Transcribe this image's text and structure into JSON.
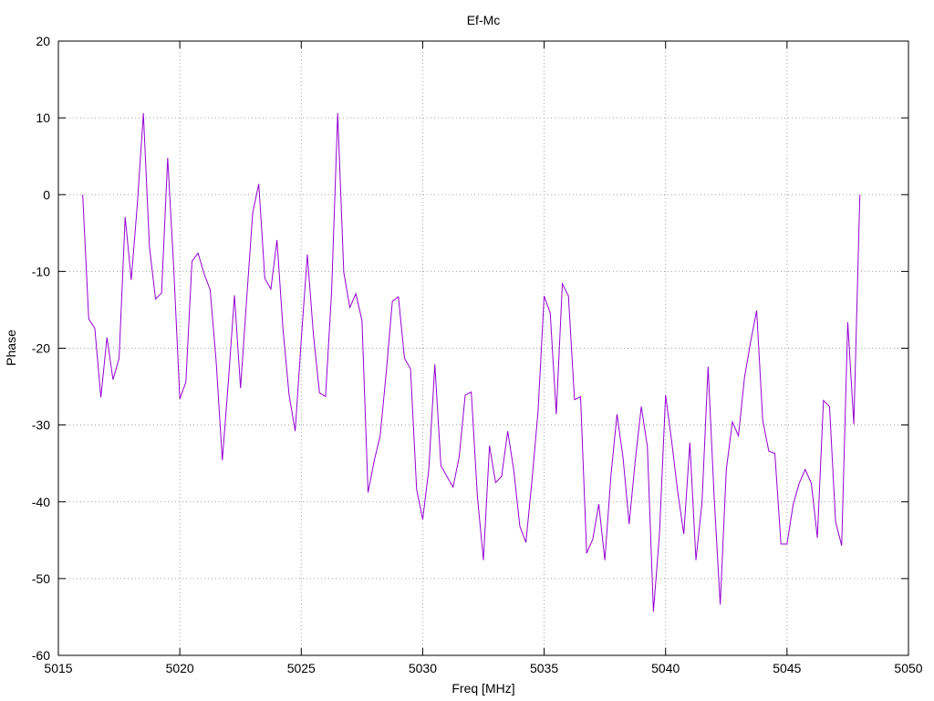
{
  "chart_data": {
    "type": "line",
    "title": "Ef-Mc",
    "xlabel": "Freq [MHz]",
    "ylabel": "Phase",
    "xlim": [
      5015,
      5050
    ],
    "ylim": [
      -60,
      20
    ],
    "xticks": [
      5015,
      5020,
      5025,
      5030,
      5035,
      5040,
      5045,
      5050
    ],
    "yticks": [
      20,
      10,
      0,
      -10,
      -20,
      -30,
      -40,
      -50,
      -60
    ],
    "grid": true,
    "legend": "none",
    "series": [
      {
        "color": "#9400d3",
        "x": [
          5016.0,
          5016.25,
          5016.5,
          5016.75,
          5017.0,
          5017.25,
          5017.5,
          5017.75,
          5018.0,
          5018.25,
          5018.5,
          5018.75,
          5019.0,
          5019.25,
          5019.5,
          5019.75,
          5020.0,
          5020.25,
          5020.5,
          5020.75,
          5021.0,
          5021.25,
          5021.5,
          5021.75,
          5022.0,
          5022.25,
          5022.5,
          5022.75,
          5023.0,
          5023.25,
          5023.5,
          5023.75,
          5024.0,
          5024.25,
          5024.5,
          5024.75,
          5025.0,
          5025.25,
          5025.5,
          5025.75,
          5026.0,
          5026.25,
          5026.5,
          5026.75,
          5027.0,
          5027.25,
          5027.5,
          5027.75,
          5028.0,
          5028.25,
          5028.5,
          5028.75,
          5029.0,
          5029.25,
          5029.5,
          5029.75,
          5030.0,
          5030.25,
          5030.5,
          5030.75,
          5031.0,
          5031.25,
          5031.5,
          5031.75,
          5032.0,
          5032.25,
          5032.5,
          5032.75,
          5033.0,
          5033.25,
          5033.5,
          5033.75,
          5034.0,
          5034.25,
          5034.5,
          5034.75,
          5035.0,
          5035.25,
          5035.5,
          5035.75,
          5036.0,
          5036.25,
          5036.5,
          5036.75,
          5037.0,
          5037.25,
          5037.5,
          5037.75,
          5038.0,
          5038.25,
          5038.5,
          5038.75,
          5039.0,
          5039.25,
          5039.5,
          5039.75,
          5040.0,
          5040.25,
          5040.5,
          5040.75,
          5041.0,
          5041.25,
          5041.5,
          5041.75,
          5042.0,
          5042.25,
          5042.5,
          5042.75,
          5043.0,
          5043.25,
          5043.5,
          5043.75,
          5044.0,
          5044.25,
          5044.5,
          5044.75,
          5045.0,
          5045.25,
          5045.5,
          5045.75,
          5046.0,
          5046.25,
          5046.5,
          5046.75,
          5047.0,
          5047.25,
          5047.5,
          5047.75,
          5048.0
        ],
        "y": [
          0,
          -16.2,
          -17.4,
          -26.4,
          -18.6,
          -24.1,
          -21.3,
          -2.9,
          -11.1,
          -1.3,
          10.6,
          -6.8,
          -13.6,
          -12.8,
          4.8,
          -9.6,
          -26.6,
          -24.4,
          -8.7,
          -7.6,
          -10.3,
          -12.4,
          -21.9,
          -34.6,
          -24.3,
          -13.1,
          -25.2,
          -13.7,
          -2.4,
          1.4,
          -10.9,
          -12.3,
          -5.9,
          -17.6,
          -26.1,
          -30.8,
          -18.9,
          -7.8,
          -18.2,
          -25.8,
          -26.3,
          -12.6,
          10.6,
          -10.1,
          -14.7,
          -12.9,
          -16.4,
          -38.8,
          -34.7,
          -31.4,
          -23.1,
          -13.9,
          -13.3,
          -21.3,
          -22.7,
          -38.4,
          -42.3,
          -35.8,
          -22.1,
          -35.3,
          -36.7,
          -38.1,
          -34.2,
          -26.1,
          -25.7,
          -39.2,
          -47.6,
          -32.7,
          -37.5,
          -36.7,
          -30.8,
          -35.9,
          -43.2,
          -45.3,
          -37.2,
          -28.2,
          -13.2,
          -15.4,
          -28.6,
          -11.6,
          -13.2,
          -26.7,
          -26.3,
          -46.7,
          -44.9,
          -40.3,
          -47.6,
          -36.6,
          -28.6,
          -34.3,
          -42.9,
          -34.7,
          -27.6,
          -32.8,
          -54.3,
          -44.1,
          -26.1,
          -32.1,
          -38.7,
          -44.2,
          -32.3,
          -47.6,
          -40.1,
          -22.4,
          -39.4,
          -53.4,
          -35.8,
          -29.6,
          -31.4,
          -23.8,
          -19.2,
          -15.1,
          -29.4,
          -33.4,
          -33.7,
          -45.5,
          -45.5,
          -40.4,
          -37.6,
          -35.8,
          -37.6,
          -44.7,
          -26.8,
          -27.6,
          -42.6,
          -45.7,
          -16.6,
          -29.9,
          0
        ]
      }
    ]
  }
}
